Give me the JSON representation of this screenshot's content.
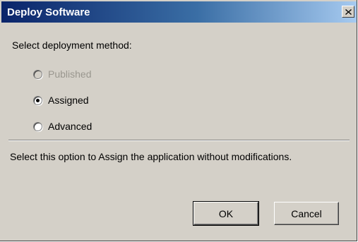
{
  "window": {
    "title": "Deploy Software",
    "close_icon": "close-icon"
  },
  "dialog": {
    "heading": "Select deployment method:",
    "options": [
      {
        "label": "Published",
        "selected": false,
        "enabled": false
      },
      {
        "label": "Assigned",
        "selected": true,
        "enabled": true
      },
      {
        "label": "Advanced",
        "selected": false,
        "enabled": true
      }
    ],
    "description": "Select this option to Assign the application without modifications."
  },
  "buttons": {
    "ok_label": "OK",
    "cancel_label": "Cancel"
  }
}
